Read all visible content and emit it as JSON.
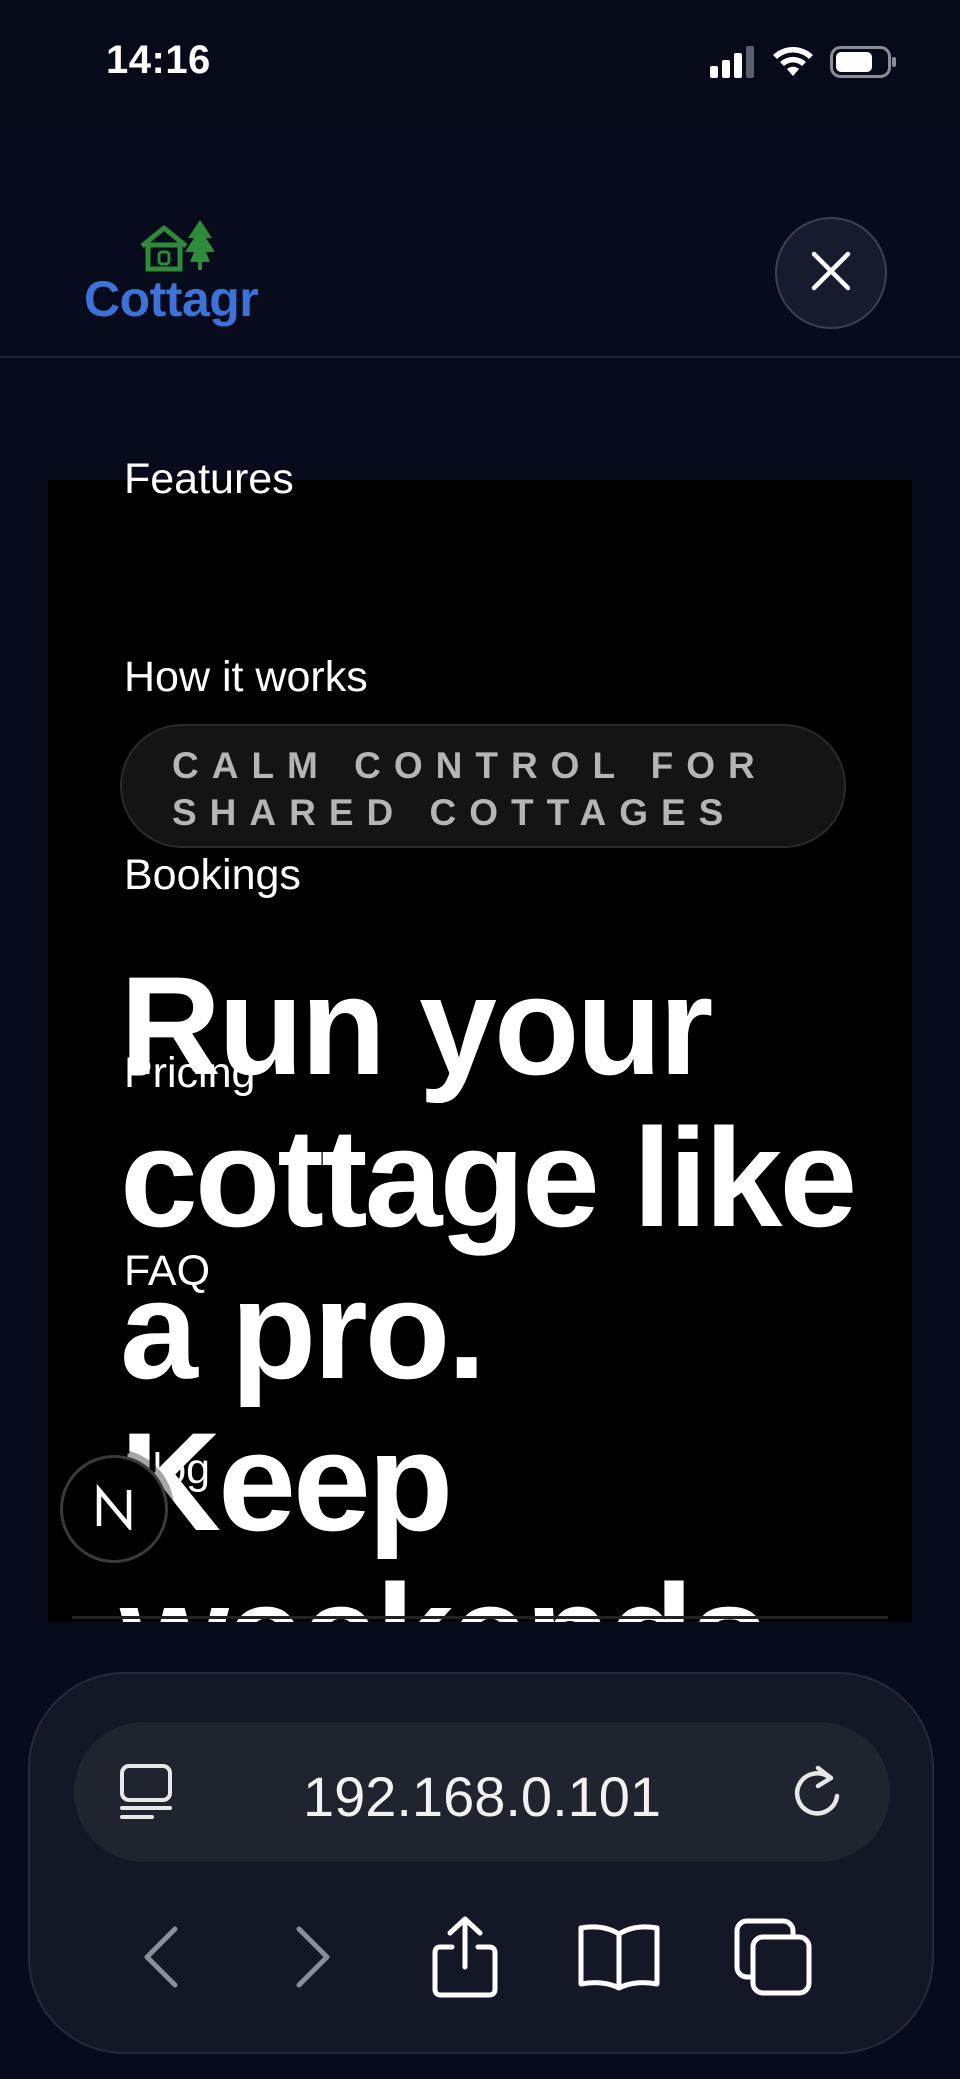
{
  "status_bar": {
    "time": "14:16"
  },
  "brand": {
    "name": "Cottagr",
    "logo_color": "#3d72d8",
    "mark_color": "#2e8b3a"
  },
  "menu": {
    "items": [
      {
        "label": "Features"
      },
      {
        "label": "How it works"
      },
      {
        "label": "Bookings"
      },
      {
        "label": "Pricing"
      },
      {
        "label": "FAQ"
      },
      {
        "label": "Blog"
      }
    ]
  },
  "hero": {
    "eyebrow_line1": "CALM CONTROL FOR",
    "eyebrow_line2": "SHARED COTTAGES",
    "title_lines": [
      "Run your",
      "cottage like",
      "a pro.",
      "Keep",
      "weekends"
    ]
  },
  "browser": {
    "url": "192.168.0.101"
  },
  "icons": {
    "close": "close-icon",
    "reader": "reader-mode-icon",
    "reload": "reload-icon",
    "back": "back-icon",
    "forward": "forward-icon",
    "share": "share-icon",
    "bookmarks": "book-icon",
    "tabs": "tabs-icon",
    "dev_badge": "n-badge-icon"
  },
  "colors": {
    "background": "#070b1c",
    "hero_panel": "#000000",
    "accent": "#3d72d8"
  }
}
